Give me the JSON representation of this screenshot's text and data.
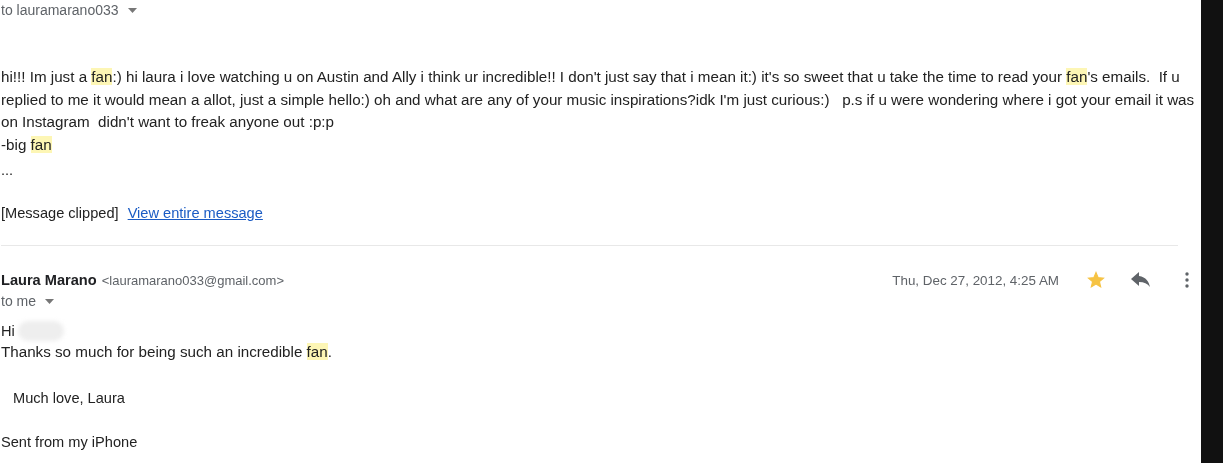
{
  "earlier_message": {
    "recipient": "to lauramarano033",
    "body_lines": [
      [
        {
          "text": "hi!!! Im just a ",
          "highlighted": false
        },
        {
          "text": "fan",
          "highlighted": true
        },
        {
          "text": ":) hi laura i love watching u on Austin and Ally i think ur incredible!! I don't just say that i mean it:) it's so sweet that u take the time to read your ",
          "highlighted": false
        },
        {
          "text": "fan",
          "highlighted": true
        },
        {
          "text": "'s emails.  If u",
          "highlighted": false
        }
      ],
      [
        {
          "text": "replied to me it would mean a allot, just a simple hello:) oh and what are any of your music inspirations?idk I'm just curious:)   p.s if u were wondering where i got your email it was",
          "highlighted": false
        }
      ],
      [
        {
          "text": "on Instagram  didn't want to freak anyone out :p:p",
          "highlighted": false
        }
      ],
      [
        {
          "text": "-big ",
          "highlighted": false
        },
        {
          "text": "fan",
          "highlighted": true
        }
      ]
    ],
    "ellipsis": "...",
    "clip_notice": "[Message clipped]",
    "clip_link": "View entire message"
  },
  "message": {
    "sender_name": "Laura Marano",
    "sender_email": "<lauramarano033@gmail.com>",
    "recipient": "to me",
    "date": "Thu, Dec 27, 2012, 4:25 AM",
    "starred": true,
    "greeting": "Hi",
    "body_lines": [
      [
        {
          "text": "Thanks so much for being such an incredible ",
          "highlighted": false
        },
        {
          "text": "fan",
          "highlighted": true
        },
        {
          "text": ".",
          "highlighted": false
        }
      ]
    ],
    "signoff": "Much love, Laura",
    "signature": "Sent from my iPhone"
  }
}
